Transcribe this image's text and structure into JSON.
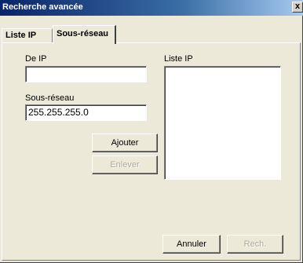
{
  "window": {
    "title": "Recherche avancée",
    "close_glyph": "x"
  },
  "tabs": [
    {
      "label": "Liste IP",
      "active": false
    },
    {
      "label": "Sous-réseau",
      "active": true
    }
  ],
  "form": {
    "from_ip_label": "De IP",
    "from_ip_value": "",
    "subnet_label": "Sous-réseau",
    "subnet_value": "255.255.255.0",
    "ip_list_label": "Liste IP",
    "ip_list_items": []
  },
  "buttons": {
    "add_label": "Ajouter",
    "remove_label": "Enlever",
    "cancel_label": "Annuler",
    "search_label": "Rech."
  },
  "colors": {
    "dialog_bg": "#ece9d8",
    "title_bar": "#0a246a",
    "disabled_text": "#aca899"
  }
}
